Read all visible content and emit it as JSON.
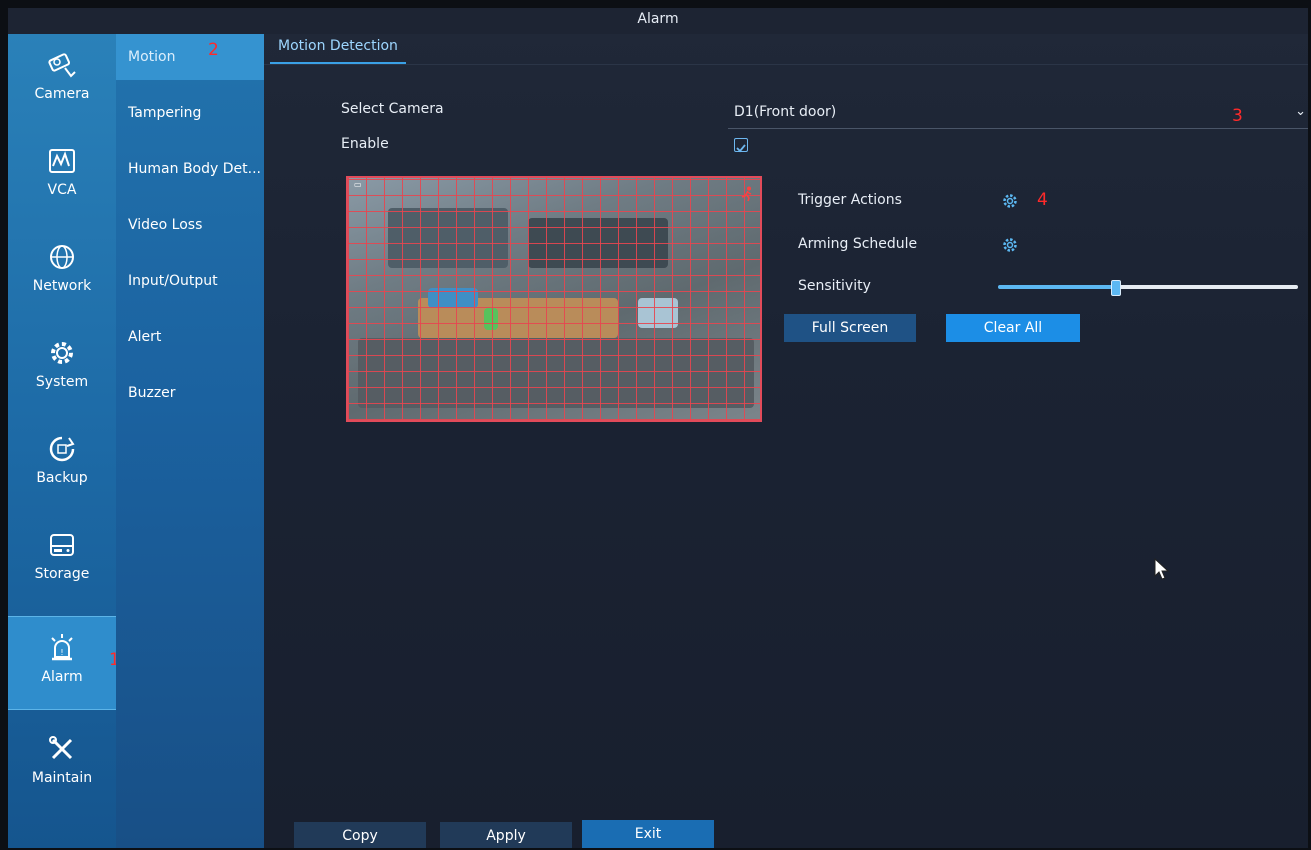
{
  "window": {
    "title": "Alarm"
  },
  "sidebar": {
    "items": [
      {
        "label": "Camera",
        "icon": "camera-icon"
      },
      {
        "label": "VCA",
        "icon": "vca-icon"
      },
      {
        "label": "Network",
        "icon": "globe-icon"
      },
      {
        "label": "System",
        "icon": "gear-icon"
      },
      {
        "label": "Backup",
        "icon": "backup-icon"
      },
      {
        "label": "Storage",
        "icon": "storage-icon"
      },
      {
        "label": "Alarm",
        "icon": "alarm-icon",
        "active": true
      },
      {
        "label": "Maintain",
        "icon": "tools-icon"
      }
    ]
  },
  "submenu": {
    "items": [
      {
        "label": "Motion",
        "active": true
      },
      {
        "label": "Tampering"
      },
      {
        "label": "Human Body Det..."
      },
      {
        "label": "Video Loss"
      },
      {
        "label": "Input/Output"
      },
      {
        "label": "Alert"
      },
      {
        "label": "Buzzer"
      }
    ]
  },
  "annotations": {
    "m1": "1",
    "m2": "2",
    "m3": "3",
    "m4": "4"
  },
  "main": {
    "tab": "Motion Detection",
    "select_camera_label": "Select Camera",
    "camera_value": "D1(Front door)",
    "enable_label": "Enable",
    "enable_checked": true,
    "trigger_actions_label": "Trigger Actions",
    "arming_schedule_label": "Arming Schedule",
    "sensitivity_label": "Sensitivity",
    "sensitivity_level": 0.39,
    "full_screen_label": "Full Screen",
    "clear_all_label": "Clear All"
  },
  "footer": {
    "copy_label": "Copy",
    "apply_label": "Apply",
    "exit_label": "Exit"
  },
  "colors": {
    "rail": "#1d6aa6",
    "submenu": "#1b62a0",
    "accent": "#3aa0e6",
    "grid": "#e24b5a",
    "annotation": "#ff2a2a"
  }
}
